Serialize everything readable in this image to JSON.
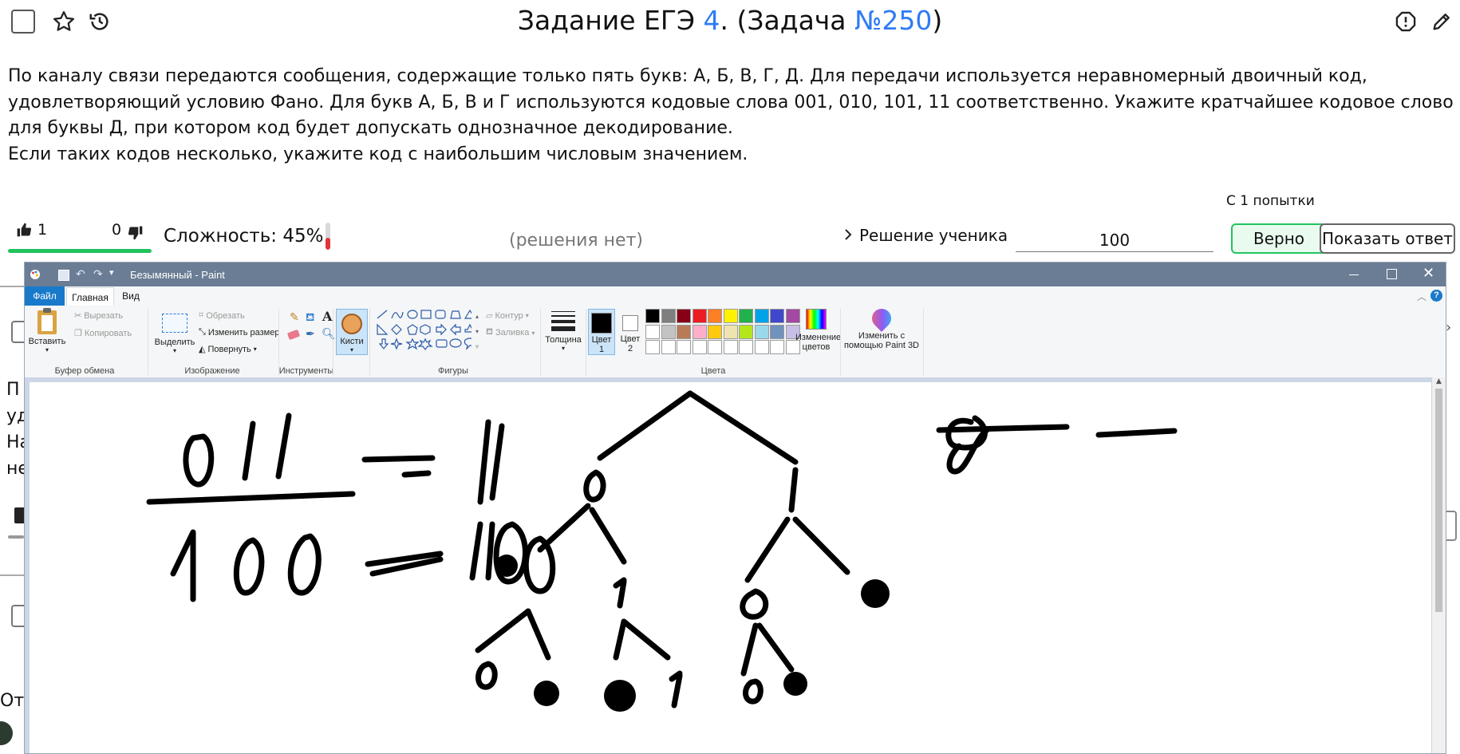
{
  "header": {
    "title_prefix": "Задание ЕГЭ ",
    "task_number": "4",
    "title_middle": ". (Задача ",
    "problem_number": "№250",
    "title_suffix": ")"
  },
  "problem": {
    "paragraph1": "По каналу связи передаются сообщения, содержащие только пять букв: А, Б, В, Г, Д. Для передачи используется неравномерный двоичный код, удовлетворяющий условию Фано. Для букв А, Б, В и Г используются кодовые слова 001, 010, 101, 11 соответственно. Укажите кратчайшее кодовое слово для буквы Д, при котором код будет допускать однозначное декодирование.",
    "paragraph2": "Если таких кодов несколько, укажите код с наибольшим числовым значением."
  },
  "rating": {
    "likes": "1",
    "dislikes": "0"
  },
  "difficulty": {
    "label": "Сложность: 45%",
    "value": 0.45
  },
  "no_solution": "(решения нет)",
  "student_solution": "Решение ученика",
  "answer": {
    "value": "100",
    "attempts": "С 1 попытки"
  },
  "buttons": {
    "correct": "Верно",
    "show_answer": "Показать ответ"
  },
  "behind_window": {
    "letters": [
      "П",
      "уд",
      "На",
      "не"
    ],
    "bottom_text": "От"
  },
  "paint": {
    "title": "Безымянный - Paint",
    "tabs": [
      "Файл",
      "Главная",
      "Вид"
    ],
    "clipboard": {
      "paste": "Вставить",
      "cut": "Вырезать",
      "copy": "Копировать",
      "label": "Буфер обмена"
    },
    "image": {
      "select": "Выделить",
      "crop": "Обрезать",
      "resize": "Изменить размер",
      "rotate": "Повернуть",
      "label": "Изображение"
    },
    "tools": {
      "label": "Инструменты"
    },
    "brushes": {
      "label": "Кисти"
    },
    "shapes": {
      "outline": "Контур",
      "fill": "Заливка",
      "label": "Фигуры"
    },
    "size": {
      "label": "Толщина"
    },
    "colors": {
      "color1": "Цвет",
      "color1_num": "1",
      "color2": "Цвет",
      "color2_num": "2",
      "edit": "Изменение",
      "edit2": "цветов",
      "paint3d": "Изменить с",
      "paint3d2": "помощью Paint 3D",
      "label": "Цвета",
      "palette_row1": [
        "#000000",
        "#7f7f7f",
        "#880015",
        "#ed1c24",
        "#ff7f27",
        "#fff200",
        "#22b14c",
        "#00a2e8",
        "#3f48cc",
        "#a349a4"
      ],
      "palette_row2": [
        "#ffffff",
        "#c3c3c3",
        "#b97a57",
        "#ffaec9",
        "#ffc90e",
        "#efe4b0",
        "#b5e61d",
        "#99d9ea",
        "#7092be",
        "#c8bfe7"
      ]
    }
  },
  "colors": {
    "accent": "#2f7bf5",
    "green": "#22c35e",
    "paint_titlebar": "#6b7d94",
    "paint_tab_active": "#1979ca"
  }
}
